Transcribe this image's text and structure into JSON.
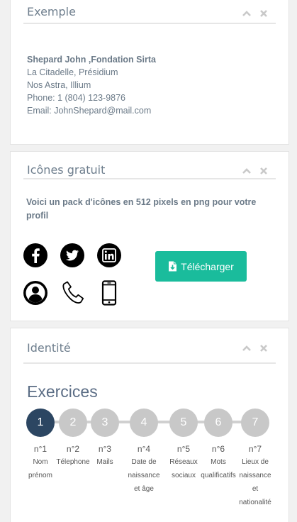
{
  "panels": {
    "exemple": {
      "title": "Exemple",
      "contact": {
        "name": "Shepard John ,Fondation Sirta",
        "line1": "La Citadelle, Présidium",
        "line2": "Nos Astra, Illium",
        "phone": "Phone: 1 (804) 123-9876",
        "email": "Email: JohnShepard@mail.com"
      }
    },
    "icones": {
      "title": "Icônes gratuit",
      "description": "Voici un pack d'icônes en 512 pixels en png pour votre profil",
      "icons": [
        "facebook-icon",
        "twitter-icon",
        "linkedin-icon",
        "user-icon",
        "phone-icon",
        "mobile-icon"
      ],
      "download_label": "Télécharger",
      "accent": "#1abc9c"
    },
    "identite": {
      "title": "Identité",
      "exercises_title": "Exercices",
      "active_color": "#2c4662",
      "steps": [
        {
          "number": "1",
          "label_num": "n°1",
          "label": "Nom prénom"
        },
        {
          "number": "2",
          "label_num": "n°2",
          "label": "Télephone"
        },
        {
          "number": "3",
          "label_num": "n°3",
          "label": "Mails"
        },
        {
          "number": "4",
          "label_num": "n°4",
          "label": "Date de naissance et âge"
        },
        {
          "number": "5",
          "label_num": "n°5",
          "label": "Réseaux sociaux"
        },
        {
          "number": "6",
          "label_num": "n°6",
          "label": "Mots qualificatifs"
        },
        {
          "number": "7",
          "label_num": "n°7",
          "label": "Lieux de naissance et nationalité"
        }
      ]
    }
  }
}
